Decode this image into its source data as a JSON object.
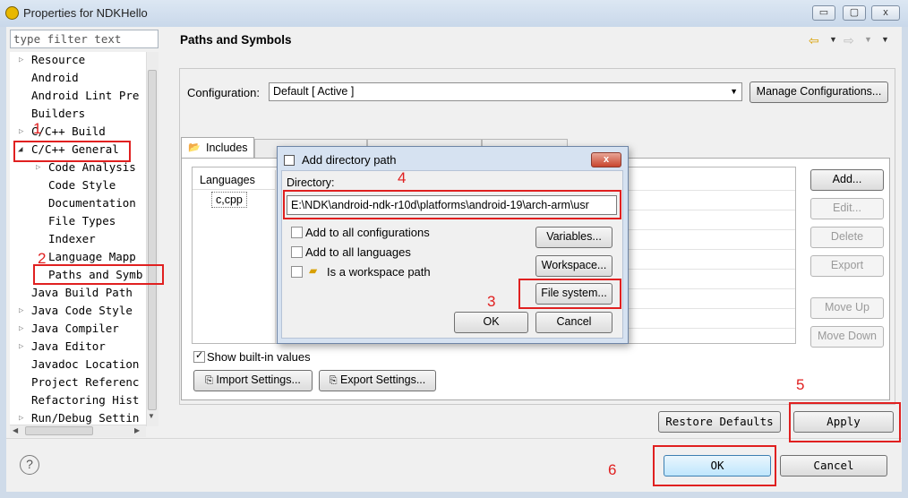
{
  "window": {
    "title": "Properties for NDKHello",
    "minimize": "▭",
    "maximize": "▢",
    "close": "x"
  },
  "filter": {
    "placeholder": "type filter text"
  },
  "tree": [
    "Resource",
    "Android",
    "Android Lint Pre",
    "Builders",
    "C/C++ Build",
    "C/C++ General",
    "Code Analysis",
    "Code Style",
    "Documentation",
    "File Types",
    "Indexer",
    "Language Mapp",
    "Paths and Symb",
    "Java Build Path",
    "Java Code Style",
    "Java Compiler",
    "Java Editor",
    "Javadoc Location",
    "Project Referenc",
    "Refactoring Hist",
    "Run/Debug Settin"
  ],
  "page": {
    "title": "Paths and Symbols",
    "configuration_label": "Configuration:",
    "configuration_value": "Default  [ Active ]",
    "manage_button": "Manage Configurations...",
    "tab_includes": "Includes",
    "languages_header": "Languages",
    "language_item": "c,cpp",
    "buttons": {
      "add": "Add...",
      "edit": "Edit...",
      "delete": "Delete",
      "export": "Export",
      "move_up": "Move Up",
      "move_down": "Move Down"
    },
    "show_builtin": "Show built-in values",
    "import_settings": "Import Settings...",
    "export_settings": "Export Settings...",
    "restore_defaults": "Restore Defaults",
    "apply": "Apply"
  },
  "dialog": {
    "title": "Add directory path",
    "directory_label": "Directory:",
    "directory_value": "E:\\NDK\\android-ndk-r10d\\platforms\\android-19\\arch-arm\\usr",
    "add_all_configs": "Add to all configurations",
    "add_all_langs": "Add to all languages",
    "workspace_path": "Is a workspace path",
    "variables": "Variables...",
    "workspace": "Workspace...",
    "file_system": "File system...",
    "ok": "OK",
    "cancel": "Cancel"
  },
  "footer": {
    "ok": "OK",
    "cancel": "Cancel",
    "help": "?"
  },
  "annotations": [
    "1",
    "2",
    "3",
    "4",
    "5",
    "6"
  ]
}
